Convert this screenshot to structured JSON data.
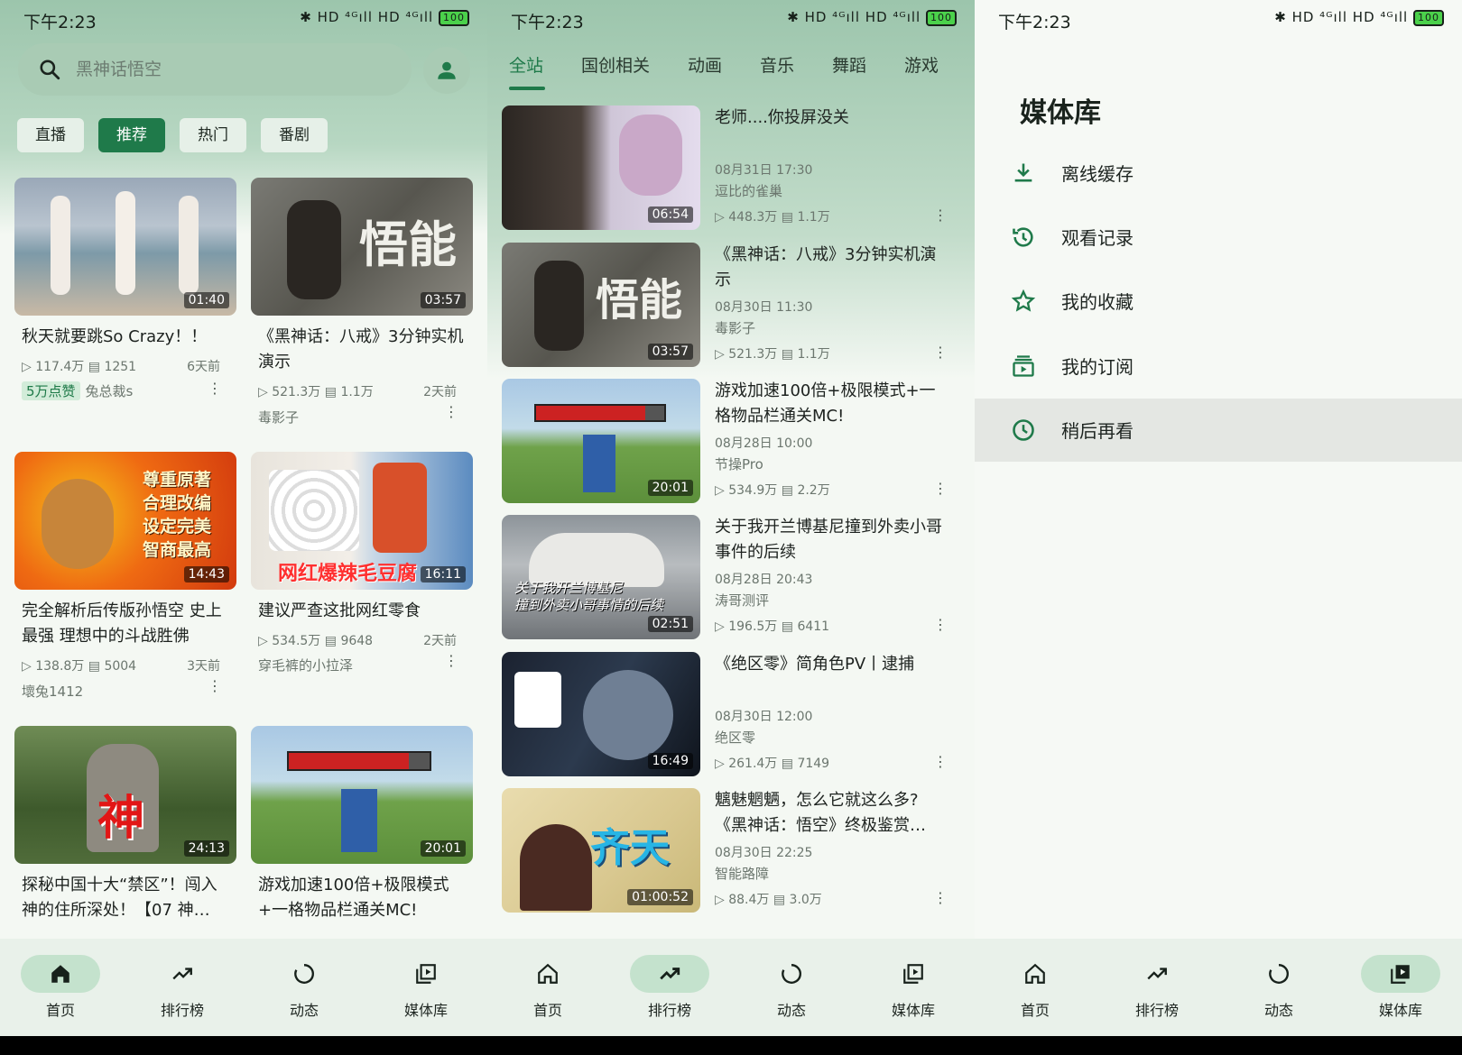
{
  "status": {
    "time": "下午2:23",
    "icons_right": "✱ HD ⁴ᴳıll HD ⁴ᴳıll",
    "battery": "100"
  },
  "panel1": {
    "search_placeholder": "黑神话悟空",
    "chips": [
      "直播",
      "推荐",
      "热门",
      "番剧"
    ],
    "cards": [
      {
        "title": "秋天就要跳So Crazy！！",
        "duration": "01:40",
        "views": "117.4万",
        "danmaku": "1251",
        "age": "6天前",
        "badge": "5万点赞",
        "author": "兔总裁s"
      },
      {
        "title": "《黑神话：八戒》3分钟实机演示",
        "duration": "03:57",
        "views": "521.3万",
        "danmaku": "1.1万",
        "age": "2天前",
        "author": "毒影子"
      },
      {
        "title": "完全解析后传版孙悟空 史上最强 理想中的斗战胜佛",
        "duration": "14:43",
        "views": "138.8万",
        "danmaku": "5004",
        "age": "3天前",
        "author": "壞兔1412",
        "thumb_text": "尊重原著\n合理改编\n设定完美\n智商最高"
      },
      {
        "title": "建议严查这批网红零食",
        "duration": "16:11",
        "views": "534.5万",
        "danmaku": "9648",
        "age": "2天前",
        "author": "穿毛裤的小拉泽",
        "thumb_text": "网红爆辣毛豆腐"
      },
      {
        "title": "探秘中国十大“禁区”！闯入神的住所深处！【07 神…",
        "duration": "24:13",
        "thumb_text": "神"
      },
      {
        "title": "游戏加速100倍+极限模式+一格物品栏通关MC!",
        "duration": "20:01"
      }
    ]
  },
  "panel2": {
    "tabs": [
      "全站",
      "国创相关",
      "动画",
      "音乐",
      "舞蹈",
      "游戏"
    ],
    "rows": [
      {
        "title": "老师....你投屏没关",
        "date": "08月31日 17:30",
        "author": "逗比的雀巢",
        "views": "448.3万",
        "danmaku": "1.1万",
        "duration": "06:54"
      },
      {
        "title": "《黑神话：八戒》3分钟实机演示",
        "date": "08月30日 11:30",
        "author": "毒影子",
        "views": "521.3万",
        "danmaku": "1.1万",
        "duration": "03:57"
      },
      {
        "title": "游戏加速100倍+极限模式+一格物品栏通关MC!",
        "date": "08月28日 10:00",
        "author": "节操Pro",
        "views": "534.9万",
        "danmaku": "2.2万",
        "duration": "20:01"
      },
      {
        "title": "关于我开兰博基尼撞到外卖小哥事件的后续",
        "date": "08月28日 20:43",
        "author": "涛哥测评",
        "views": "196.5万",
        "danmaku": "6411",
        "duration": "02:51",
        "thumb_text": "关于我开兰博基尼\n撞到外卖小哥事情的后续"
      },
      {
        "title": "《绝区零》简角色PV丨逮捕",
        "date": "08月30日 12:00",
        "author": "绝区零",
        "views": "261.4万",
        "danmaku": "7149",
        "duration": "16:49"
      },
      {
        "title": "魑魅魍魉，怎么它就这么多?《黑神话：悟空》终极鉴赏…",
        "date": "08月30日 22:25",
        "author": "智能路障",
        "views": "88.4万",
        "danmaku": "3.0万",
        "duration": "01:00:52",
        "thumb_text": "齐天"
      }
    ]
  },
  "panel3": {
    "title": "媒体库",
    "items": [
      {
        "label": "离线缓存",
        "icon": "download-icon"
      },
      {
        "label": "观看记录",
        "icon": "history-icon"
      },
      {
        "label": "我的收藏",
        "icon": "star-icon"
      },
      {
        "label": "我的订阅",
        "icon": "subscription-icon"
      },
      {
        "label": "稍后再看",
        "icon": "clock-icon"
      }
    ]
  },
  "nav": [
    "首页",
    "排行榜",
    "动态",
    "媒体库"
  ],
  "colors": {
    "accent": "#1f7a4a",
    "header_tint": "#9cc5ac"
  }
}
